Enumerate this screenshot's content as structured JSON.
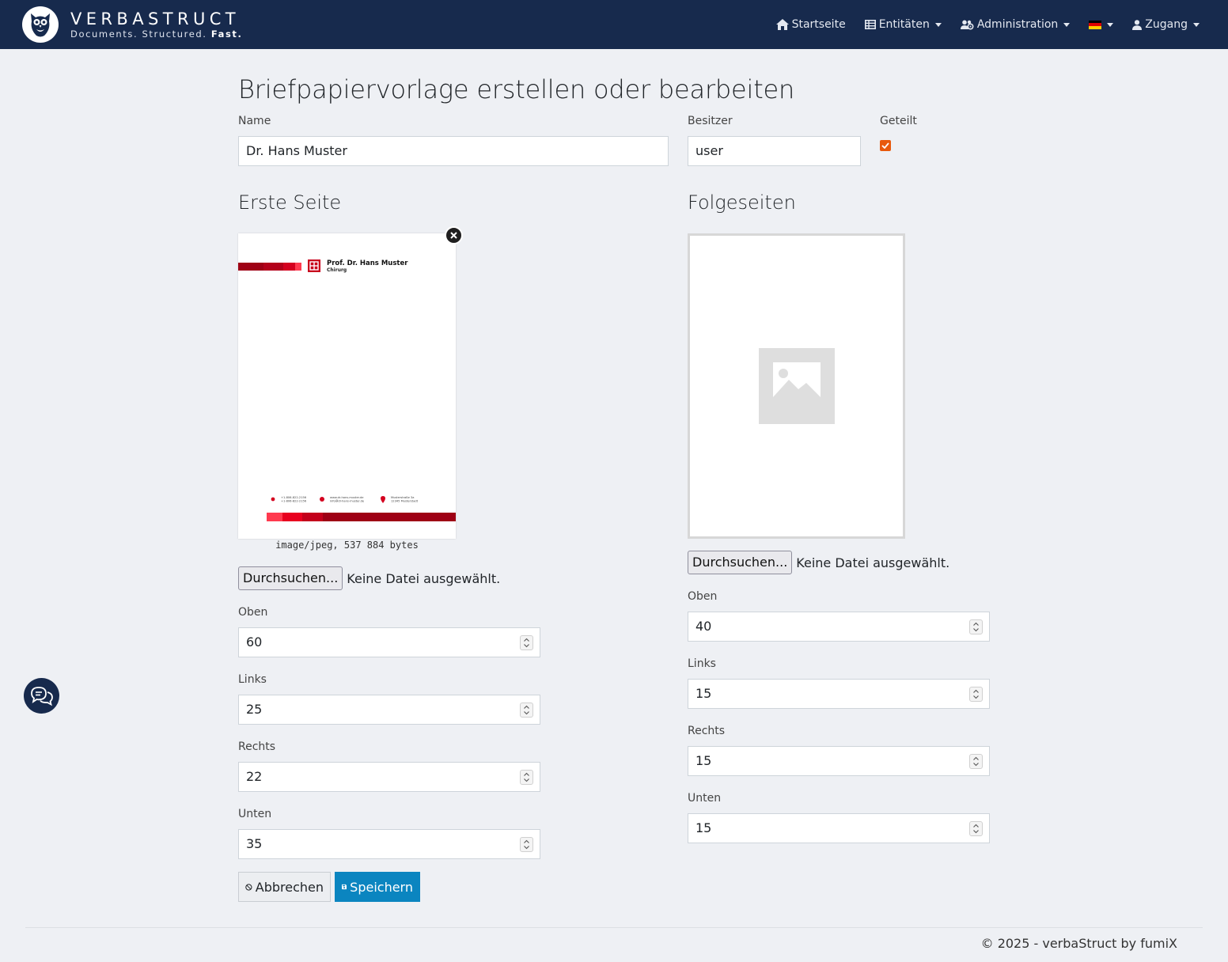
{
  "brand": {
    "name": "VERBASTRUCT",
    "tagline_prefix": "Documents. Structured.",
    "tagline_bold": "Fast."
  },
  "nav": {
    "home": "Startseite",
    "entities": "Entitäten",
    "administration": "Administration",
    "language_flag_colors": [
      "#000000",
      "#dd0000",
      "#ffce00"
    ],
    "account": "Zugang"
  },
  "page": {
    "title": "Briefpapiervorlage erstellen oder bearbeiten"
  },
  "form": {
    "name_label": "Name",
    "name_value": "Dr. Hans Muster",
    "owner_label": "Besitzer",
    "owner_value": "user",
    "shared_label": "Geteilt",
    "shared_checked": true,
    "accent_color": "#e8590c"
  },
  "first_page": {
    "title": "Erste Seite",
    "preview": {
      "letterhead_name": "Prof. Dr. Hans Muster",
      "letterhead_title": "Chirurg",
      "phone": "+1-806-822-2156",
      "fax": "+1-806-822-2156",
      "web": "www.dr-hans-muster.de",
      "email": "info@dr-hans-muster.de",
      "street": "Musterstraße 3a",
      "city": "12345 Musterstadt"
    },
    "file_info": "image/jpeg, 537 884 bytes",
    "browse_label": "Durchsuchen...",
    "no_file_label": "Keine Datei ausgewählt.",
    "top_label": "Oben",
    "top_value": "60",
    "left_label": "Links",
    "left_value": "25",
    "right_label": "Rechts",
    "right_value": "22",
    "bottom_label": "Unten",
    "bottom_value": "35"
  },
  "follow_pages": {
    "title": "Folgeseiten",
    "browse_label": "Durchsuchen...",
    "no_file_label": "Keine Datei ausgewählt.",
    "top_label": "Oben",
    "top_value": "40",
    "left_label": "Links",
    "left_value": "15",
    "right_label": "Rechts",
    "right_value": "15",
    "bottom_label": "Unten",
    "bottom_value": "15"
  },
  "actions": {
    "cancel": "Abbrechen",
    "save": "Speichern"
  },
  "footer": {
    "text": "© 2025 - verbaStruct by fumiX"
  }
}
